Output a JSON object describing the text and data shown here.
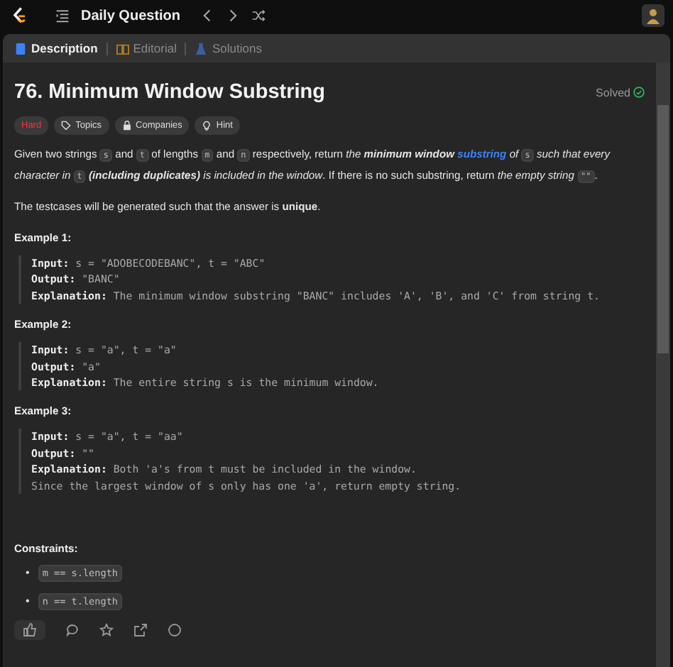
{
  "topbar": {
    "title": "Daily Question"
  },
  "tabs": [
    {
      "label": "Description",
      "selected": true
    },
    {
      "label": "Editorial",
      "selected": false
    },
    {
      "label": "Solutions",
      "selected": false
    }
  ],
  "problem": {
    "title": "76. Minimum Window Substring",
    "status": "Solved",
    "solved": true,
    "tags": [
      {
        "label": "Hard",
        "kind": "difficulty"
      },
      {
        "label": "Topics",
        "kind": "topics"
      },
      {
        "label": "Companies",
        "kind": "companies"
      },
      {
        "label": "Hint",
        "kind": "hint"
      }
    ],
    "description": [
      {
        "kind": "text",
        "text": "Given two strings "
      },
      {
        "kind": "code",
        "text": "s"
      },
      {
        "kind": "text",
        "text": " and "
      },
      {
        "kind": "code",
        "text": "t"
      },
      {
        "kind": "text",
        "text": " of lengths "
      },
      {
        "kind": "code",
        "text": "m"
      },
      {
        "kind": "text",
        "text": " and "
      },
      {
        "kind": "code",
        "text": "n"
      },
      {
        "kind": "text",
        "text": " respectively, return "
      },
      {
        "kind": "italic",
        "text": "the "
      },
      {
        "kind": "bolditalic",
        "text": "minimum window "
      },
      {
        "kind": "link",
        "text": "substring"
      },
      {
        "kind": "italic",
        "text": " of "
      },
      {
        "kind": "code",
        "text": "s"
      },
      {
        "kind": "italic",
        "text": " such that every character in "
      },
      {
        "kind": "code",
        "text": "t"
      },
      {
        "kind": "bolditalic",
        "text": " (including duplicates)"
      },
      {
        "kind": "italic",
        "text": " is included in the window"
      },
      {
        "kind": "text",
        "text": ". If there is no such substring, return "
      },
      {
        "kind": "italic",
        "text": "the empty string "
      },
      {
        "kind": "code",
        "text": "\"\""
      },
      {
        "kind": "text",
        "text": "."
      }
    ],
    "note": "The testcases will be generated such that the answer is **unique**.",
    "examples": [
      {
        "heading": "Example 1:",
        "labels": {
          "input": "Input:",
          "output": "Output:",
          "explanation": "Explanation:"
        },
        "input": "s = \"ADOBECODEBANC\", t = \"ABC\"",
        "output": "\"BANC\"",
        "explanation": [
          "The minimum window substring \"BANC\" includes 'A', 'B', and 'C' from string t."
        ]
      },
      {
        "heading": "Example 2:",
        "labels": {
          "input": "Input:",
          "output": "Output:",
          "explanation": "Explanation:"
        },
        "input": "s = \"a\", t = \"a\"",
        "output": "\"a\"",
        "explanation": [
          "The entire string s is the minimum window."
        ]
      },
      {
        "heading": "Example 3:",
        "labels": {
          "input": "Input:",
          "output": "Output:",
          "explanation": "Explanation:"
        },
        "input": "s = \"a\", t = \"aa\"",
        "output": "\"\"",
        "explanation": [
          "Both 'a's from t must be included in the window.",
          "Since the largest window of s only has one 'a', return empty string."
        ]
      }
    ],
    "constraints_heading": "Constraints:",
    "constraints": [
      {
        "bullet": "•",
        "code": "m == s.length"
      },
      {
        "bullet": "•",
        "code": "n == t.length"
      }
    ]
  }
}
